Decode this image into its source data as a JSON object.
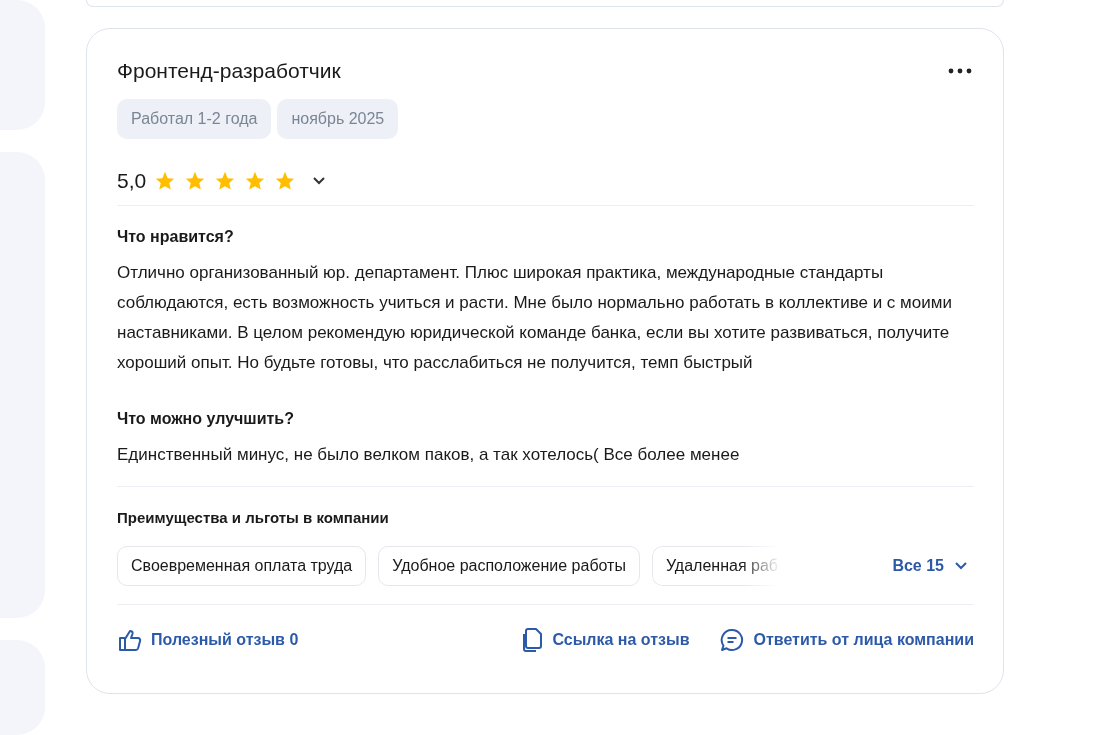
{
  "review": {
    "title": "Фронтенд-разработчик",
    "tags": [
      "Работал 1-2 года",
      "ноябрь 2025"
    ],
    "rating": "5,0",
    "stars": 5,
    "sections": [
      {
        "heading": "Что нравится?",
        "text": "Отлично организованный юр. департамент. Плюс широкая практика, международные стандарты соблюдаются, есть возможность учиться и расти. Мне было нормально работать в коллективе и с моими наставниками. В целом рекомендую юридической команде банка, если вы хотите развиваться, получите хороший опыт. Но будьте готовы, что расслабиться не получится, темп быстрый"
      },
      {
        "heading": "Что можно улучшить?",
        "text": "Единственный минус, не было велком паков, а так хотелось( Все более менее"
      }
    ],
    "benefits": {
      "heading": "Преимущества и льготы в компании",
      "items": [
        "Своевременная оплата труда",
        "Удобное расположение работы",
        "Удаленная раб"
      ],
      "more": "Все 15"
    },
    "actions": [
      {
        "kind": "like",
        "label": "Полезный отзыв 0"
      },
      {
        "kind": "link",
        "label": "Ссылка на отзыв"
      },
      {
        "kind": "reply",
        "label": "Ответить от лица компании"
      }
    ]
  }
}
